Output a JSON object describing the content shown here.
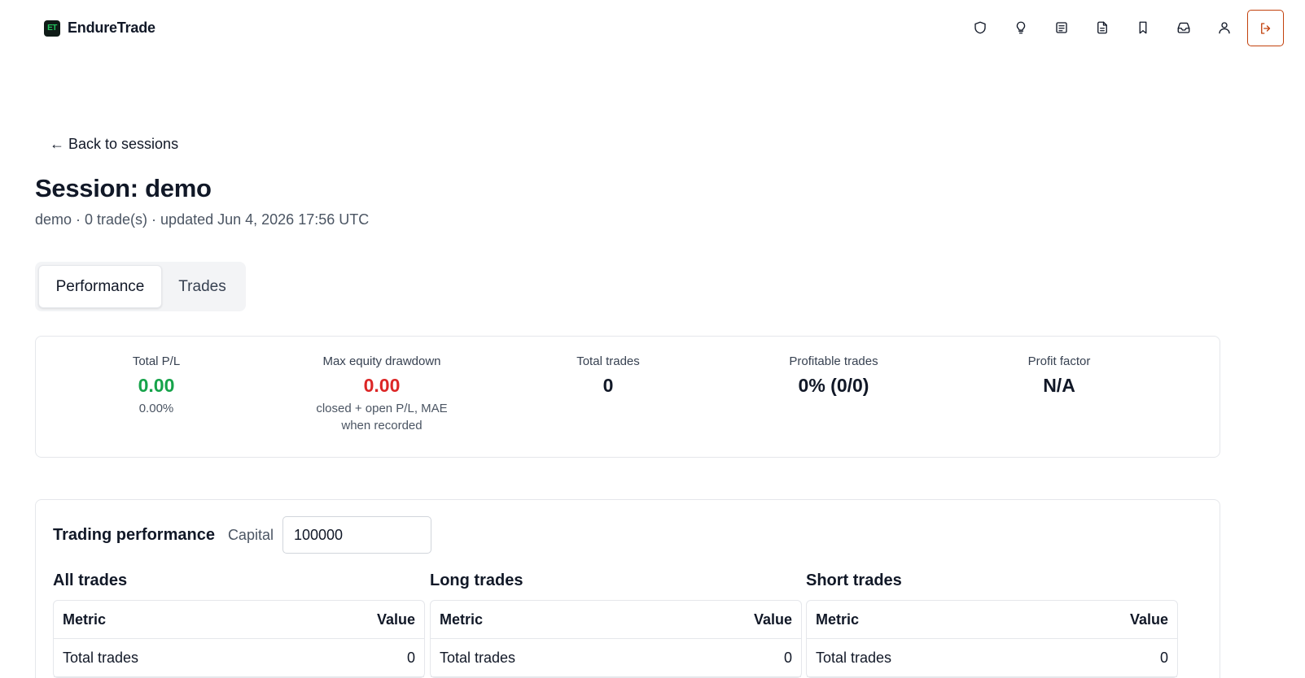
{
  "app": {
    "logo_text": "ET",
    "name": "EndureTrade"
  },
  "nav": {
    "icons": [
      "shield-icon",
      "lightbulb-icon",
      "newspaper-icon",
      "document-icon",
      "bookmark-icon",
      "inbox-icon",
      "user-icon"
    ],
    "logout_icon": "logout-icon"
  },
  "colors": {
    "positive": "#16a34a",
    "negative": "#dc2626",
    "accent": "#c2410c"
  },
  "back_link": "← Back to sessions",
  "page_title": "Session: demo",
  "subtitle": "demo · 0 trade(s) · updated Jun 4, 2026 17:56 UTC",
  "tabs": [
    {
      "label": "Performance",
      "active": true
    },
    {
      "label": "Trades",
      "active": false
    }
  ],
  "stats": [
    {
      "label": "Total P/L",
      "value": "0.00",
      "sub": "0.00%"
    },
    {
      "label": "Max equity drawdown",
      "value": "0.00",
      "sub": "closed + open P/L, MAE when recorded"
    },
    {
      "label": "Total trades",
      "value": "0",
      "sub": ""
    },
    {
      "label": "Profitable trades",
      "value": "0% (0/0)",
      "sub": ""
    },
    {
      "label": "Profit factor",
      "value": "N/A",
      "sub": ""
    }
  ],
  "performance": {
    "title": "Trading performance",
    "capital_label": "Capital",
    "capital_value": "100000",
    "columns": [
      {
        "title": "All trades",
        "header": {
          "metric": "Metric",
          "value": "Value"
        },
        "rows": [
          {
            "metric": "Total trades",
            "value": "0"
          }
        ]
      },
      {
        "title": "Long trades",
        "header": {
          "metric": "Metric",
          "value": "Value"
        },
        "rows": [
          {
            "metric": "Total trades",
            "value": "0"
          }
        ]
      },
      {
        "title": "Short trades",
        "header": {
          "metric": "Metric",
          "value": "Value"
        },
        "rows": [
          {
            "metric": "Total trades",
            "value": "0"
          }
        ]
      }
    ]
  }
}
